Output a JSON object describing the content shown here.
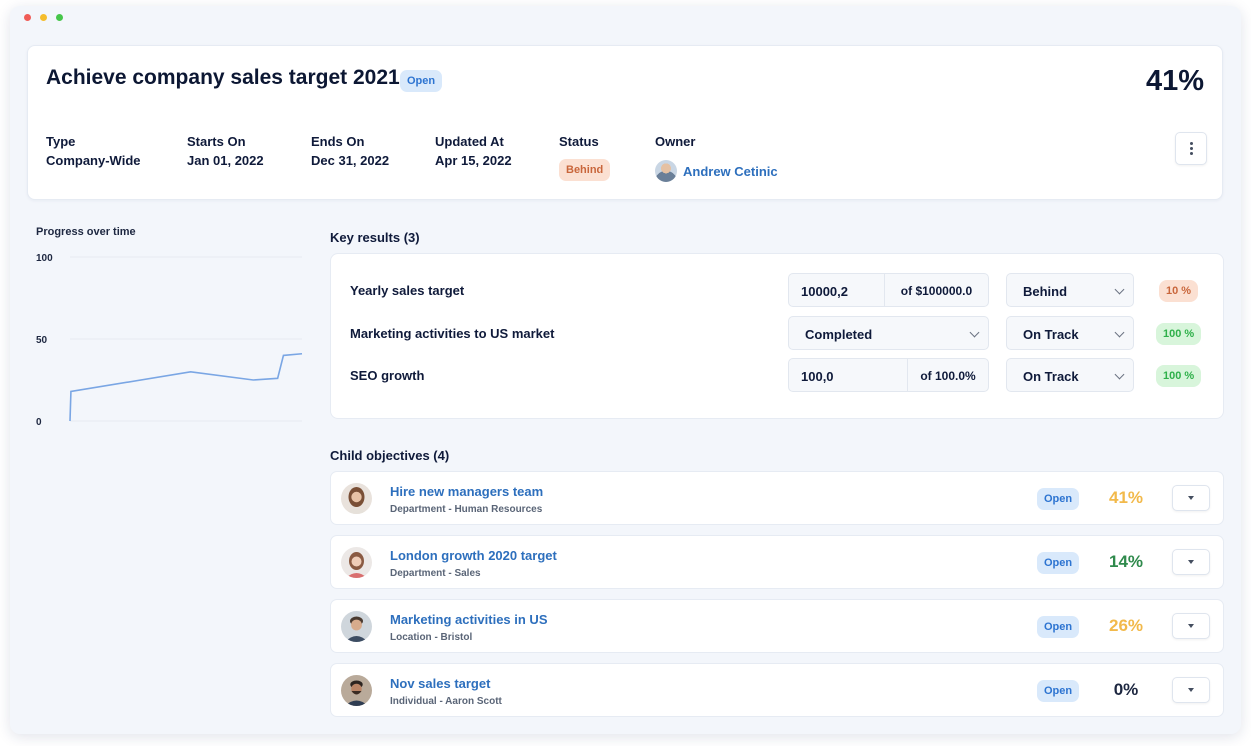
{
  "objective": {
    "title": "Achieve company sales target 2021",
    "state_badge": "Open",
    "progress": "41%"
  },
  "meta": {
    "type_label": "Type",
    "type_value": "Company-Wide",
    "starts_label": "Starts On",
    "starts_value": "Jan 01, 2022",
    "ends_label": "Ends On",
    "ends_value": "Dec 31, 2022",
    "updated_label": "Updated At",
    "updated_value": "Apr 15, 2022",
    "status_label": "Status",
    "status_value": "Behind",
    "owner_label": "Owner",
    "owner_name": "Andrew Cetinic"
  },
  "progress_chart": {
    "title": "Progress over time",
    "chart_data": {
      "type": "line",
      "title": "Progress over time",
      "y_ticks": [
        "100",
        "50",
        "0"
      ],
      "ylim": [
        0,
        100
      ],
      "grid": true,
      "values": [
        0,
        18,
        30,
        25,
        26,
        40,
        41
      ],
      "line_color": "#7aa6e4"
    }
  },
  "key_results": {
    "heading": "Key results (3)",
    "rows": [
      {
        "name": "Yearly sales target",
        "value": "10000,2",
        "of": "of $100000.0",
        "status": "Behind",
        "pct": "10 %",
        "pct_tone": "red"
      },
      {
        "name": "Marketing activities to US market",
        "select_value": "Completed",
        "status": "On Track",
        "pct": "100 %",
        "pct_tone": "green"
      },
      {
        "name": "SEO growth",
        "value": "100,0",
        "of": "of 100.0%",
        "status": "On Track",
        "pct": "100 %",
        "pct_tone": "green"
      }
    ]
  },
  "child_objectives": {
    "heading": "Child objectives (4)",
    "items": [
      {
        "title": "Hire new managers team",
        "subtitle": "Department - Human Resources",
        "badge": "Open",
        "pct": "41%",
        "pct_color": "#f2b94a"
      },
      {
        "title": "London growth 2020 target",
        "subtitle": "Department - Sales",
        "badge": "Open",
        "pct": "14%",
        "pct_color": "#2f8a4c"
      },
      {
        "title": "Marketing activities in US",
        "subtitle": "Location - Bristol",
        "badge": "Open",
        "pct": "26%",
        "pct_color": "#f2b94a"
      },
      {
        "title": "Nov sales target",
        "subtitle": "Individual - Aaron Scott",
        "badge": "Open",
        "pct": "0%",
        "pct_color": "#1d2740"
      }
    ]
  },
  "colors": {
    "accent_blue": "#2d6fbd",
    "behind": "#c9663b",
    "on_track": "#2fb04a"
  }
}
